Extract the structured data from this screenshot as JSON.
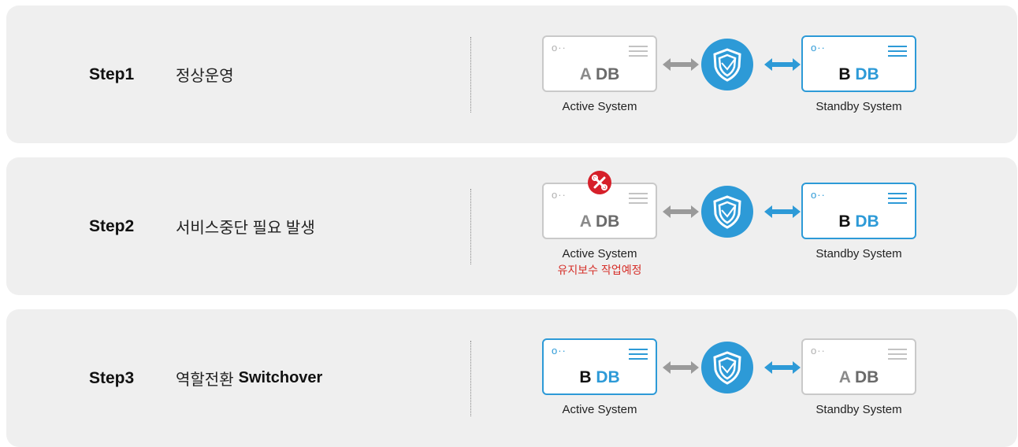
{
  "steps": [
    {
      "label": "Step1",
      "desc": "정상운영",
      "desc_bold": "",
      "left": {
        "letter": "A",
        "db": "DB",
        "style": "gray",
        "caption": "Active System",
        "note": ""
      },
      "right": {
        "letter": "B",
        "db": "DB",
        "style": "blue",
        "caption": "Standby System"
      }
    },
    {
      "label": "Step2",
      "desc": "서비스중단 필요 발생",
      "desc_bold": "",
      "left": {
        "letter": "A",
        "db": "DB",
        "style": "gray",
        "caption": "Active System",
        "note": "유지보수 작업예정",
        "alert_icon": "maintenance-wrench-icon"
      },
      "right": {
        "letter": "B",
        "db": "DB",
        "style": "blue",
        "caption": "Standby System"
      }
    },
    {
      "label": "Step3",
      "desc": "역할전환",
      "desc_bold": "Switchover",
      "left": {
        "letter": "B",
        "db": "DB",
        "style": "blue",
        "caption": "Active System",
        "note": ""
      },
      "right": {
        "letter": "A",
        "db": "DB",
        "style": "gray",
        "caption": "Standby System"
      }
    }
  ],
  "icons": {
    "shield": "shield-icon",
    "gray_arrow": "bidirectional-arrow-gray-icon",
    "blue_arrow": "bidirectional-arrow-blue-icon"
  },
  "colors": {
    "accent": "#2d9ad7",
    "panel_bg": "#efefef",
    "alert": "#d6202a",
    "inactive": "#c9c9c9"
  }
}
